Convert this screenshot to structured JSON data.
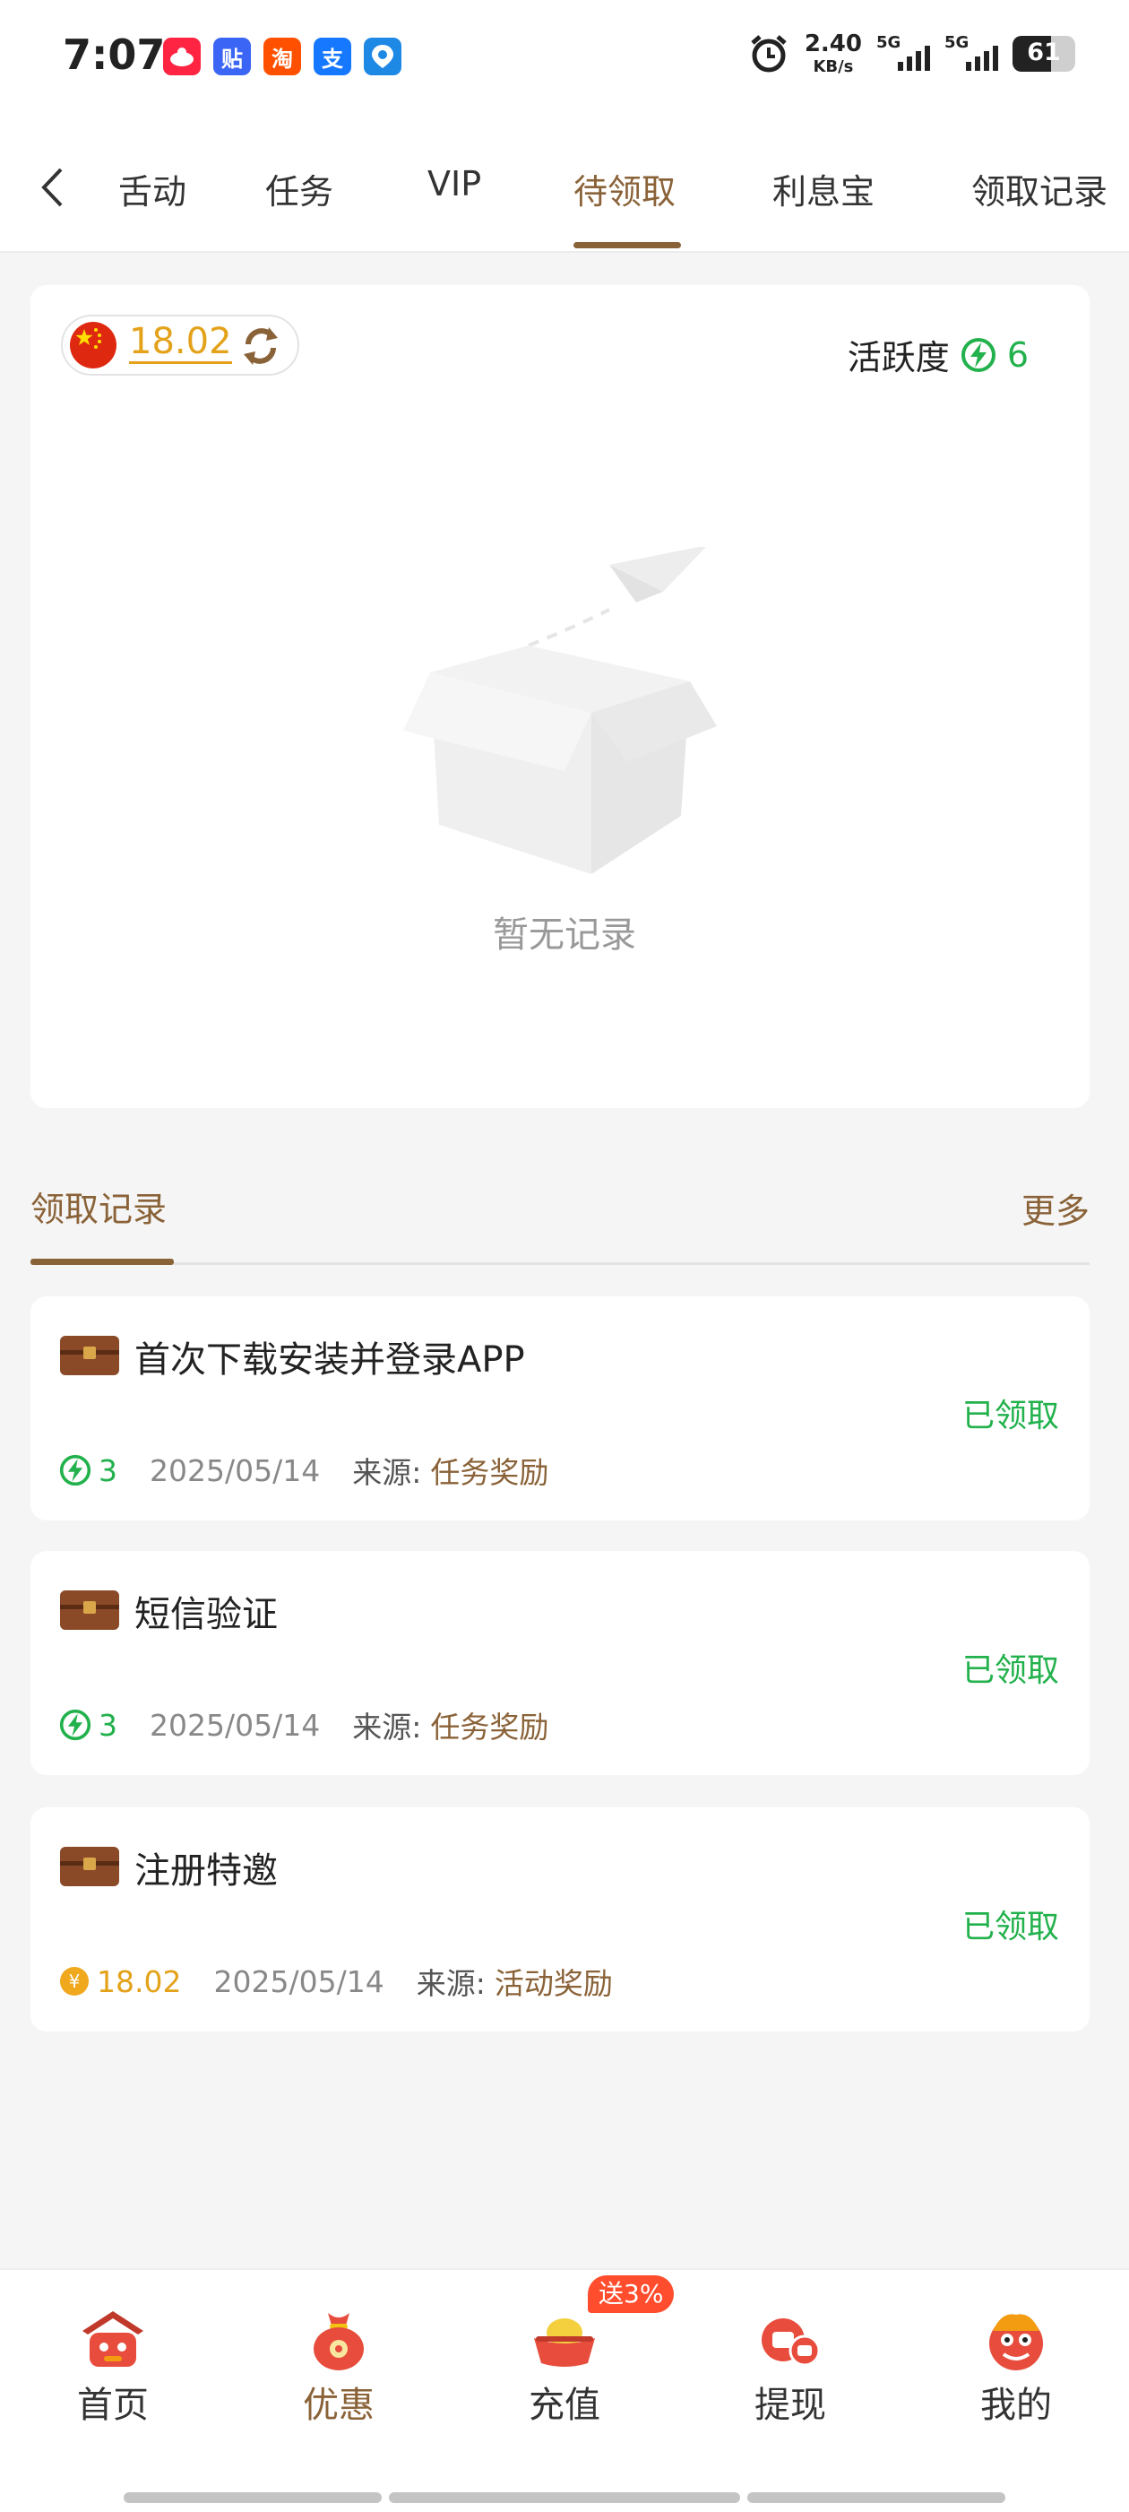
{
  "status_bar": {
    "time": "7:07",
    "apps": [
      {
        "name": "xiaohongshu",
        "glyph": "",
        "color": "#ff2442"
      },
      {
        "name": "tieba",
        "glyph": "贴",
        "color": "#3b66f5"
      },
      {
        "name": "taobao",
        "glyph": "淘",
        "color": "#ff5000"
      },
      {
        "name": "alipay",
        "glyph": "支",
        "color": "#1677ff"
      },
      {
        "name": "location-app",
        "glyph": "",
        "color": "#1e88e5"
      }
    ],
    "net_speed_value": "2.40",
    "net_speed_unit": "KB/s",
    "signal_1": "5G",
    "signal_2": "5G",
    "battery": "61",
    "battery_level": 0.61
  },
  "tabs": [
    {
      "label": "活动",
      "visible_text": "舌动",
      "active": false
    },
    {
      "label": "任务",
      "active": false
    },
    {
      "label": "VIP",
      "active": false
    },
    {
      "label": "待领取",
      "active": true
    },
    {
      "label": "利息宝",
      "active": false
    },
    {
      "label": "领取记录",
      "active": false
    }
  ],
  "summary": {
    "balance": "18.02",
    "activity_label": "活跃度",
    "activity_value": "6",
    "empty_text": "暂无记录"
  },
  "records_section": {
    "title": "领取记录",
    "more": "更多"
  },
  "records": [
    {
      "name": "首次下载安装并登录APP",
      "status": "已领取",
      "reward_type": "points",
      "value": "3",
      "date": "2025/05/14",
      "source_label": "来源:",
      "source": "任务奖励"
    },
    {
      "name": "短信验证",
      "status": "已领取",
      "reward_type": "points",
      "value": "3",
      "date": "2025/05/14",
      "source_label": "来源:",
      "source": "任务奖励"
    },
    {
      "name": "注册特邀",
      "status": "已领取",
      "reward_type": "money",
      "value": "18.02",
      "date": "2025/05/14",
      "source_label": "来源:",
      "source": "活动奖励"
    }
  ],
  "bottom_nav": [
    {
      "label": "首页",
      "icon": "home-icon",
      "active": false
    },
    {
      "label": "优惠",
      "icon": "discount-bag-icon",
      "active": true
    },
    {
      "label": "充值",
      "icon": "recharge-ingot-icon",
      "active": false
    },
    {
      "label": "提现",
      "icon": "withdraw-icon",
      "active": false
    },
    {
      "label": "我的",
      "icon": "profile-lion-icon",
      "active": false
    }
  ],
  "recharge_badge": "送3%",
  "colors": {
    "accent": "#8a6238",
    "green": "#22b14c",
    "gold": "#e3a21a"
  }
}
